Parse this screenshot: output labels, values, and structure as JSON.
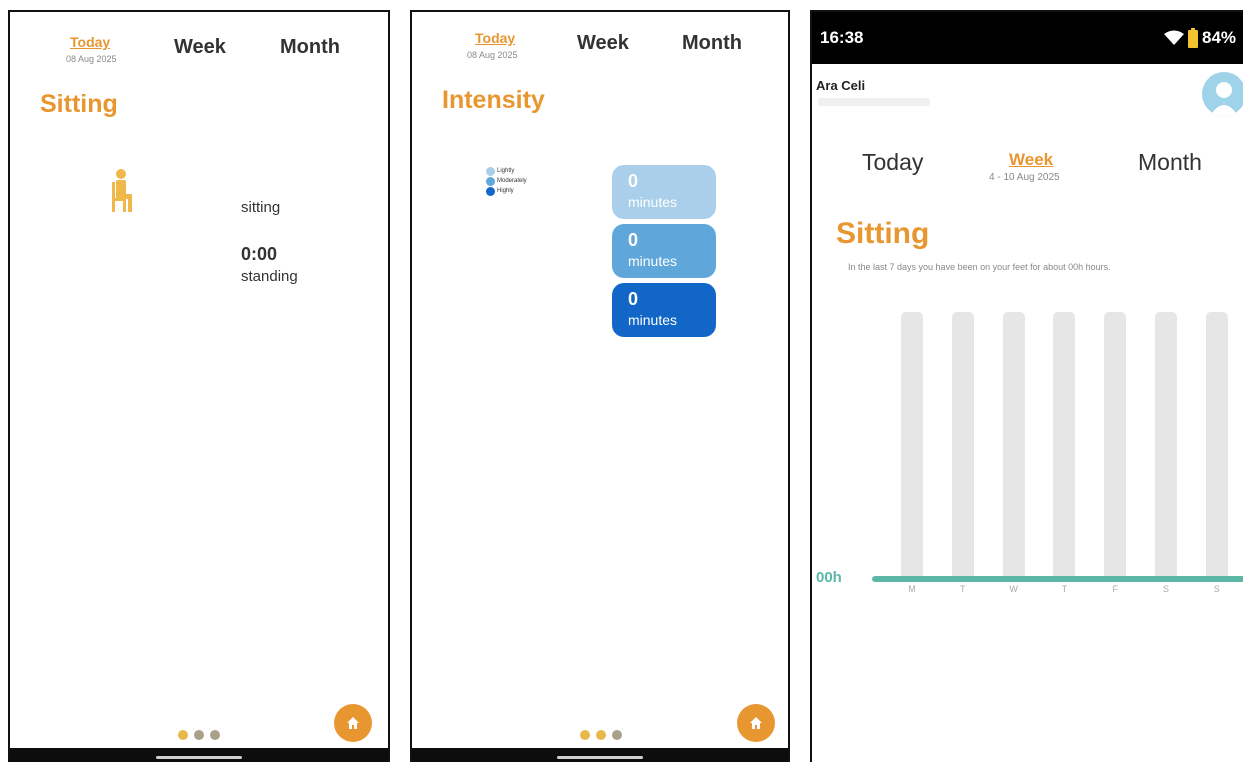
{
  "panel1": {
    "tabs": {
      "today": "Today",
      "today_date": "08 Aug 2025",
      "week": "Week",
      "month": "Month"
    },
    "title": "Sitting",
    "sitting_label": "sitting",
    "standing_value": "0:00",
    "standing_label": "standing",
    "icon": "sitting-person-icon"
  },
  "panel2": {
    "tabs": {
      "today": "Today",
      "today_date": "08 Aug 2025",
      "week": "Week",
      "month": "Month"
    },
    "title": "Intensity",
    "legend": [
      "Lightly",
      "Moderately",
      "Highly"
    ],
    "boxes": [
      {
        "value": "0",
        "unit": "minutes",
        "color": "#a9cfea"
      },
      {
        "value": "0",
        "unit": "minutes",
        "color": "#5fa7da"
      },
      {
        "value": "0",
        "unit": "minutes",
        "color": "#1266c8"
      }
    ]
  },
  "panel3": {
    "status": {
      "time": "16:38",
      "battery": "84%"
    },
    "user_name": "Ara Celi",
    "tabs": {
      "today": "Today",
      "week": "Week",
      "week_range": "4 - 10 Aug 2025",
      "month": "Month"
    },
    "title": "Sitting",
    "subtitle": "In the last 7 days you have been on your feet for about 00h hours.",
    "axis_label": "00h",
    "chart_data": {
      "type": "bar",
      "categories": [
        "M",
        "T",
        "W",
        "T",
        "F",
        "S",
        "S"
      ],
      "values": [
        0,
        0,
        0,
        0,
        0,
        0,
        0
      ]
    }
  },
  "colors": {
    "accent": "#e8962f",
    "teal": "#5bb8a6"
  }
}
